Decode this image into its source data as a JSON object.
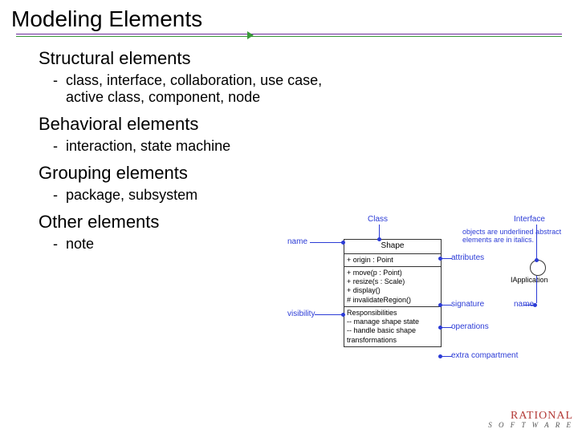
{
  "title": "Modeling Elements",
  "sections": [
    {
      "head": "Structural elements",
      "items": [
        "class, interface, collaboration, use case, active class, component, node"
      ]
    },
    {
      "head": "Behavioral elements",
      "items": [
        "interaction, state machine"
      ]
    },
    {
      "head": "Grouping elements",
      "items": [
        "package, subsystem"
      ]
    },
    {
      "head": "Other elements",
      "items": [
        "note"
      ]
    }
  ],
  "diagram": {
    "top_left": "Class",
    "top_right": "Interface",
    "note_right": "objects are underlined abstract elements are in italics.",
    "name": "name",
    "attributes": "attributes",
    "visibility": "visibility",
    "signature": "signature",
    "iface_name_lbl": "name",
    "operations": "operations",
    "extra": "extra compartment",
    "classbox": {
      "cname": "Shape",
      "attr": "+ origin : Point",
      "ops": "+ move(p : Point)\n+ resize(s : Scale)\n+ display()\n# invalidateRegion()",
      "resp": "Responsibilities\n-- manage shape state\n-- handle basic shape transformations"
    },
    "iface_label": "IApplication"
  },
  "logo": {
    "brand": "RATIONAL",
    "sub": "S O F T W A R E"
  }
}
